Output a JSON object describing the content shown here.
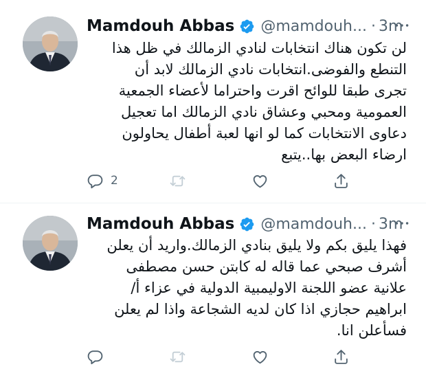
{
  "tweets": [
    {
      "author": {
        "name": "Mamdouh Abbas",
        "handle": "@mamdouh...",
        "verified": true
      },
      "time": "3m",
      "separator": "·",
      "lines": [
        "لن تكون هناك انتخابات لنادي الزمالك في ظل هذا",
        "التنطع والفوضى.انتخابات نادي الزمالك لابد أن",
        "تجرى طبقا للوائح اقرت واحتراما لأعضاء الجمعية",
        "العمومية ومحبي وعشاق نادي الزمالك اما تعجيل",
        "دعاوى الانتخابات كما لو انها لعبة أطفال يحاولون",
        "ارضاء البعض بها..يتبع"
      ],
      "actions": {
        "reply_count": "2",
        "retweet_count": "",
        "like_count": ""
      }
    },
    {
      "author": {
        "name": "Mamdouh Abbas",
        "handle": "@mamdouh...",
        "verified": true
      },
      "time": "3m",
      "separator": "·",
      "lines": [
        "فهذا يليق بكم ولا يليق بنادي الزمالك.واريد أن يعلن",
        "أشرف صبحي عما قاله له كابتن حسن مصطفى",
        "علانية عضو اللجنة الاوليمبية الدولية في عزاء أ/",
        "ابراهيم حجازي اذا كان لديه الشجاعة واذا لم يعلن",
        "فسأعلن انا."
      ],
      "actions": {
        "reply_count": "",
        "retweet_count": "",
        "like_count": ""
      }
    }
  ],
  "colors": {
    "text": "#0f1419",
    "secondary": "#536471",
    "verified_badge": "#1d9bf0",
    "retweet_disabled": "#c4cfd6",
    "divider": "#eff3f4"
  },
  "icons": {
    "verified": "verified-badge-icon",
    "more": "more-icon",
    "reply": "reply-icon",
    "retweet": "retweet-icon",
    "like": "like-icon",
    "share": "share-icon"
  }
}
